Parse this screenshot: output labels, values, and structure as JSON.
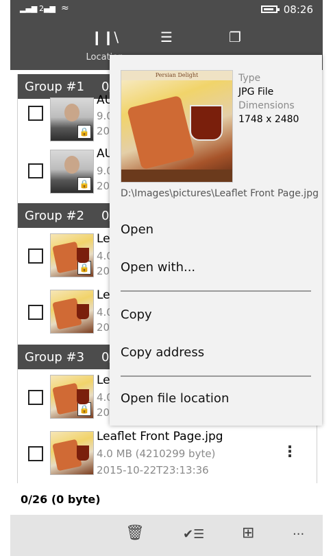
{
  "status": {
    "signal1": "▂▄▆",
    "signal2": "2▄▆",
    "wifi": "≈",
    "time": "08:26"
  },
  "nav": {
    "tabs": [
      {
        "icon": "library-icon",
        "glyph": "❙❙\\",
        "label": "Location"
      },
      {
        "icon": "list-icon",
        "glyph": "☰",
        "label": ""
      },
      {
        "icon": "copy-icon",
        "glyph": "❐",
        "label": ""
      }
    ]
  },
  "groups": [
    {
      "title": "Group #1",
      "count": "0/"
    },
    {
      "title": "Group #2",
      "count": "0/"
    },
    {
      "title": "Group #3",
      "count": "0/"
    }
  ],
  "items": [
    {
      "name": "AU",
      "size": "9.0",
      "date": "20"
    },
    {
      "name": "AU",
      "size": "9.0",
      "date": "20"
    },
    {
      "name": "Le",
      "size": "4.0",
      "date": "20"
    },
    {
      "name": "Le",
      "size": "4.0",
      "date": "20"
    },
    {
      "name": "Le",
      "size": "4.0",
      "date": "20"
    },
    {
      "name": "Leaflet Front Page.jpg",
      "size": "4.0 MB (4210299 byte)",
      "date": "2015-10-22T23:13:36",
      "more": "⋮"
    }
  ],
  "popup": {
    "thumb_banner": "Persian Delight",
    "type_label": "Type",
    "type_value": "JPG File",
    "dim_label": "Dimensions",
    "dim_value": "1748 x 2480",
    "path": "D:\\Images\\pictures\\Leaflet Front Page.jpg",
    "menu": {
      "open": "Open",
      "open_with": "Open with...",
      "copy": "Copy",
      "copy_address": "Copy address",
      "open_location": "Open file location"
    }
  },
  "footer": {
    "selection": "0/26 (0 byte)"
  },
  "appbar": {
    "delete": "🗑",
    "select": "✔☰",
    "grid": "⊞",
    "more": "···"
  }
}
